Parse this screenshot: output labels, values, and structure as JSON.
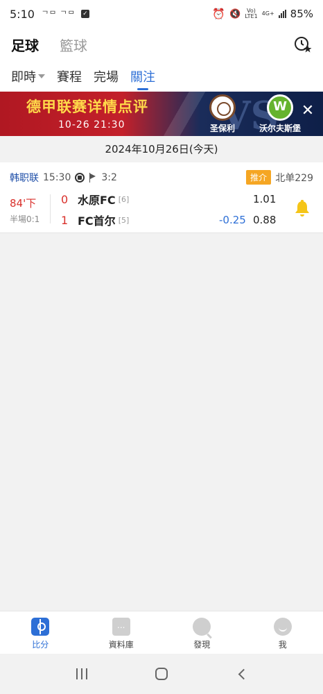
{
  "status_bar": {
    "time": "5:10",
    "notifications": "ᄀᄆ ᄀᄆ",
    "network_top": "Vo)",
    "network_bottom": "LTE1",
    "network_type": "4G+",
    "battery": "85%"
  },
  "header": {
    "sports": [
      {
        "label": "足球",
        "active": true
      },
      {
        "label": "籃球",
        "active": false
      }
    ],
    "history_icon": "clock-star-icon"
  },
  "tabs": [
    {
      "label": "即時",
      "has_dropdown": true
    },
    {
      "label": "賽程"
    },
    {
      "label": "完場"
    },
    {
      "label": "關注",
      "active": true
    }
  ],
  "banner": {
    "headline": "德甲联赛详情点评",
    "datetime": "10-26 21:30",
    "vs": "VS",
    "home_team": "圣保利",
    "away_team": "沃尔夫斯堡",
    "close_label": "✕"
  },
  "date_bar": {
    "text": "2024年10月26日(今天)"
  },
  "match": {
    "league": "韩职联",
    "time": "15:30",
    "corners": "3:2",
    "tag": "推介",
    "lottery": "北单229",
    "minute": "84'下",
    "halftime": "半場0:1",
    "home": {
      "score": "0",
      "name": "水原FC",
      "rank": "[6]",
      "handicap": "",
      "odds": "1.01"
    },
    "away": {
      "score": "1",
      "name": "FC首尔",
      "rank": "[5]",
      "handicap": "-0.25",
      "odds": "0.88"
    }
  },
  "bottom_nav": [
    {
      "label": "比分",
      "icon": "score-icon",
      "active": true
    },
    {
      "label": "資料庫",
      "icon": "database-icon"
    },
    {
      "label": "發現",
      "icon": "discover-icon"
    },
    {
      "label": "我",
      "icon": "profile-icon"
    }
  ],
  "colors": {
    "accent": "#2d6fd6",
    "live_red": "#d9302b",
    "tag_orange": "#f5a623",
    "bell_yellow": "#f5c518"
  }
}
